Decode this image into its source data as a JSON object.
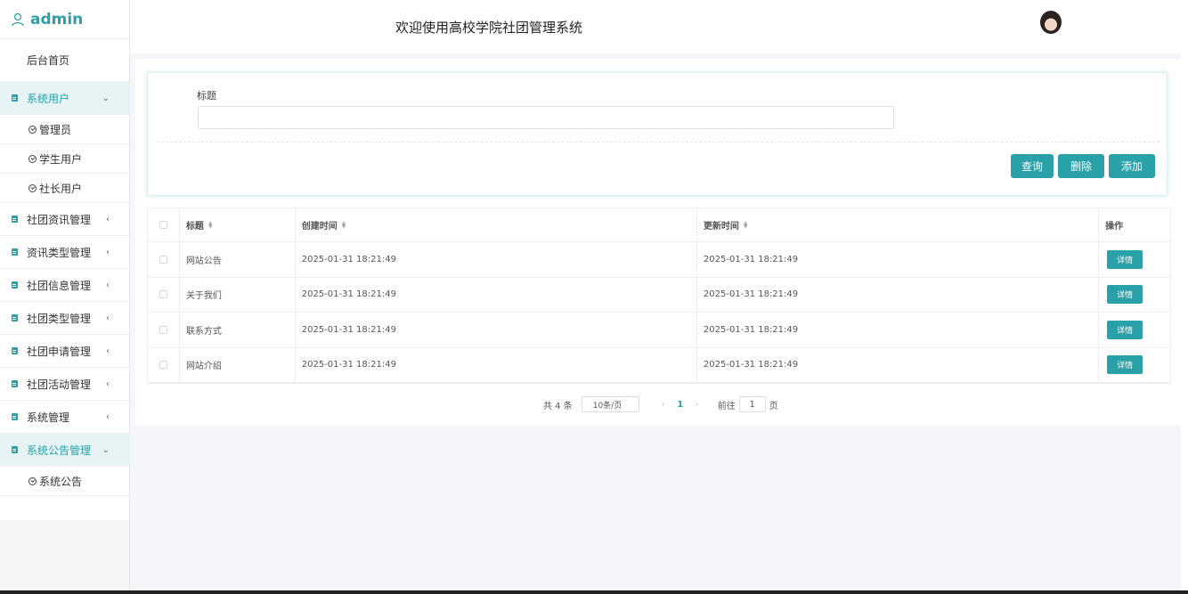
{
  "brand": {
    "name": "admin"
  },
  "header": {
    "title": "欢迎使用高校学院社团管理系统"
  },
  "sidebar": {
    "home": "后台首页",
    "groups": [
      {
        "label": "系统用户",
        "open": true,
        "children": [
          "管理员",
          "学生用户",
          "社长用户"
        ]
      },
      {
        "label": "社团资讯管理"
      },
      {
        "label": "资讯类型管理"
      },
      {
        "label": "社团信息管理"
      },
      {
        "label": "社团类型管理"
      },
      {
        "label": "社团申请管理"
      },
      {
        "label": "社团活动管理"
      },
      {
        "label": "系统管理"
      },
      {
        "label": "系统公告管理",
        "open": true,
        "children": [
          "系统公告"
        ]
      }
    ]
  },
  "search": {
    "label": "标题",
    "value": "",
    "buttons": {
      "query": "查询",
      "delete": "删除",
      "add": "添加"
    }
  },
  "table": {
    "headers": [
      "标题",
      "创建时间",
      "更新时间",
      "操作"
    ],
    "detail_label": "详情",
    "rows": [
      {
        "title": "网站公告",
        "created": "2025-01-31 18:21:49",
        "updated": "2025-01-31 18:21:49"
      },
      {
        "title": "关于我们",
        "created": "2025-01-31 18:21:49",
        "updated": "2025-01-31 18:21:49"
      },
      {
        "title": "联系方式",
        "created": "2025-01-31 18:21:49",
        "updated": "2025-01-31 18:21:49"
      },
      {
        "title": "网站介绍",
        "created": "2025-01-31 18:21:49",
        "updated": "2025-01-31 18:21:49"
      }
    ]
  },
  "pagination": {
    "total": "共 4 条",
    "page_size": "10条/页",
    "current": "1",
    "goto_label": "前往",
    "goto_value": "1",
    "page_suffix": "页"
  },
  "colors": {
    "accent": "#2aa0a8"
  }
}
